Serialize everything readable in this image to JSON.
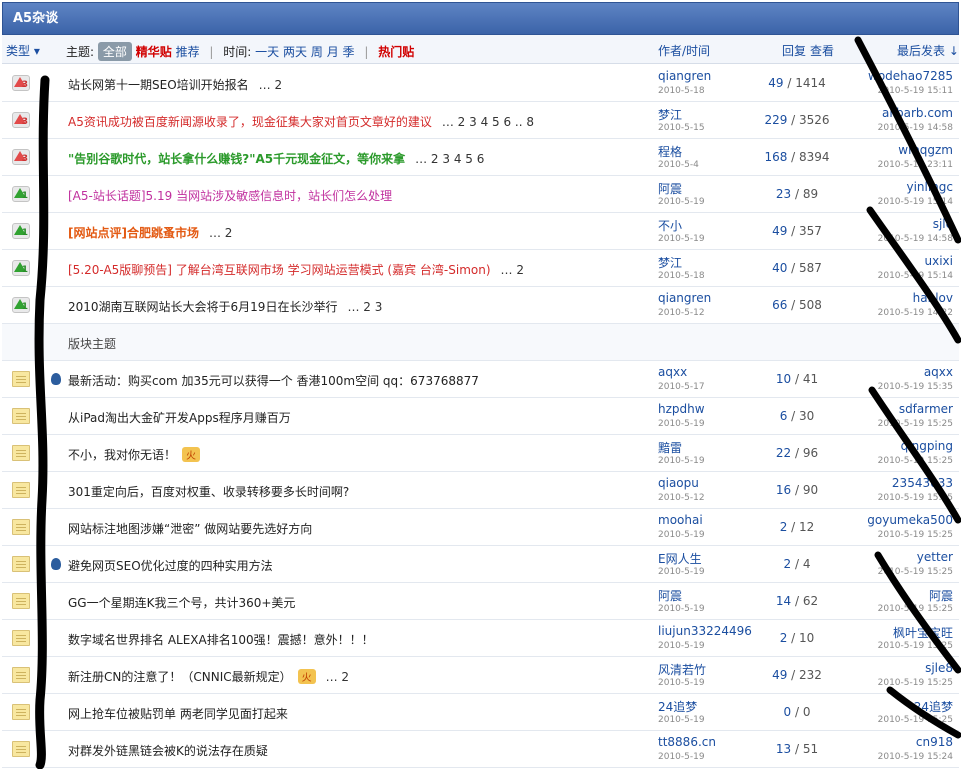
{
  "forum": {
    "title": "A5杂谈"
  },
  "header": {
    "type_label": "类型",
    "topic_label": "主题:",
    "all": "全部",
    "digest": "精华贴",
    "recommend": "推荐",
    "sep": "|",
    "time_label": "时间:",
    "time_filters": [
      "一天",
      "两天",
      "周",
      "月",
      "季"
    ],
    "hot": "热门贴",
    "author_time": "作者/时间",
    "reply": "回复",
    "view": "查看",
    "last_post": "最后发表"
  },
  "hot_threads": [
    {
      "title": "站长网第十一期SEO培训开始报名",
      "color": "#222",
      "pages": "… 2",
      "author": "qiangren",
      "date": "2010-5-18",
      "replies": "49",
      "views": "1414",
      "last_user": "wodehao7285",
      "last_time": "2010-5-19 15:11",
      "icon": "hot",
      "icon_num": "3"
    },
    {
      "title": "A5资讯成功被百度新闻源收录了，现金征集大家对首页文章好的建议",
      "color": "#d42b2b",
      "pages": "… 2 3 4 5 6 .. 8",
      "author": "梦江",
      "date": "2010-5-15",
      "replies": "229",
      "views": "3526",
      "last_user": "alibarb.com",
      "last_time": "2010-5-19 14:58",
      "icon": "hot",
      "icon_num": "3"
    },
    {
      "title": "\"告别谷歌时代，站长拿什么赚钱?\"A5千元现金征文，等你来拿",
      "color": "#2b9a2b",
      "bold": true,
      "pages": "… 2 3 4 5 6",
      "author": "程格",
      "date": "2010-5-4",
      "replies": "168",
      "views": "8394",
      "last_user": "wmqgzm",
      "last_time": "2010-5-19 23:11",
      "icon": "hot",
      "icon_num": "3"
    },
    {
      "title": "[A5-站长话题]5.19 当网站涉及敏感信息时，站长们怎么处理",
      "color": "#c0309e",
      "pages": "",
      "author": "阿震",
      "date": "2010-5-19",
      "replies": "23",
      "views": "89",
      "last_user": "yinlingc",
      "last_time": "2010-5-19 15:14",
      "icon": "up",
      "icon_num": "1"
    },
    {
      "title": "[网站点评]合肥跳蚤市场",
      "color": "#e35a13",
      "bold": true,
      "pages": "… 2",
      "author": "不小",
      "date": "2010-5-19",
      "replies": "49",
      "views": "357",
      "last_user": "sjle",
      "last_time": "2010-5-19 14:58",
      "icon": "up",
      "icon_num": "1"
    },
    {
      "title": "[5.20-A5版聊预告] 了解台湾互联网市场 学习网站运营模式 (嘉宾 台湾-Simon)",
      "color": "#d42b2b",
      "pages": "… 2",
      "author": "梦江",
      "date": "2010-5-18",
      "replies": "40",
      "views": "587",
      "last_user": "uxixi",
      "last_time": "2010-5-19 15:14",
      "icon": "up",
      "icon_num": "1"
    },
    {
      "title": "2010湖南互联网站长大会将于6月19日在长沙举行",
      "color": "#222",
      "pages": "… 2 3",
      "author": "qiangren",
      "date": "2010-5-12",
      "replies": "66",
      "views": "508",
      "last_user": "hanlov",
      "last_time": "2010-5-19 14:22",
      "icon": "up",
      "icon_num": "1"
    }
  ],
  "section_label": "版块主题",
  "threads": [
    {
      "title": "最新活动：购买com 加35元可以获得一个 香港100m空间 qq：673768877",
      "pages": "",
      "author": "aqxx",
      "date": "2010-5-17",
      "replies": "10",
      "views": "41",
      "last_user": "aqxx",
      "last_time": "2010-5-19 15:35",
      "pin": true
    },
    {
      "title": "从iPad淘出大金矿开发Apps程序月赚百万",
      "pages": "",
      "author": "hzpdhw",
      "date": "2010-5-19",
      "replies": "6",
      "views": "30",
      "last_user": "sdfarmer",
      "last_time": "2010-5-19 15:25"
    },
    {
      "title": "不小，我对你无语！",
      "pages": "",
      "author": "黯雷",
      "date": "2010-5-19",
      "replies": "22",
      "views": "96",
      "last_user": "qingping",
      "last_time": "2010-5-19 15:25",
      "tag": "火"
    },
    {
      "title": "301重定向后，百度对权重、收录转移要多长时间啊?",
      "pages": "",
      "author": "qiaopu",
      "date": "2010-5-12",
      "replies": "16",
      "views": "90",
      "last_user": "23543033",
      "last_time": "2010-5-19 15:25"
    },
    {
      "title": "网站标注地图涉嫌“泄密” 做网站要先选好方向",
      "pages": "",
      "author": "moohai",
      "date": "2010-5-19",
      "replies": "2",
      "views": "12",
      "last_user": "goyumeka500",
      "last_time": "2010-5-19 15:25"
    },
    {
      "title": "避免网页SEO优化过度的四种实用方法",
      "pages": "",
      "author": "E网人生",
      "date": "2010-5-19",
      "replies": "2",
      "views": "4",
      "last_user": "yetter",
      "last_time": "2010-5-19 15:25",
      "pin": true
    },
    {
      "title": "GG一个星期连K我三个号，共计360+美元",
      "pages": "",
      "author": "阿震",
      "date": "2010-5-19",
      "replies": "14",
      "views": "62",
      "last_user": "阿震",
      "last_time": "2010-5-19 15:25"
    },
    {
      "title": "数字域名世界排名  ALEXA排名100强！震撼！意外！！！",
      "pages": "",
      "author": "liujun33224496",
      "date": "2010-5-19",
      "replies": "2",
      "views": "10",
      "last_user": "枫叶宝宝旺",
      "last_time": "2010-5-19 15:25"
    },
    {
      "title": "新注册CN的注意了！（CNNIC最新规定）",
      "pages": "… 2",
      "author": "风清若竹",
      "date": "2010-5-19",
      "replies": "49",
      "views": "232",
      "last_user": "sjle8",
      "last_time": "2010-5-19 15:25",
      "tag": "火"
    },
    {
      "title": "网上抢车位被贴罚单  两老同学见面打起来",
      "pages": "",
      "author": "24追梦",
      "date": "2010-5-19",
      "replies": "0",
      "views": "0",
      "last_user": "24追梦",
      "last_time": "2010-5-19 15:25"
    },
    {
      "title": "对群发外链黑链会被K的说法存在质疑",
      "pages": "",
      "author": "tt8886.cn",
      "date": "2010-5-19",
      "replies": "13",
      "views": "51",
      "last_user": "cn918",
      "last_time": "2010-5-19 15:24"
    }
  ]
}
